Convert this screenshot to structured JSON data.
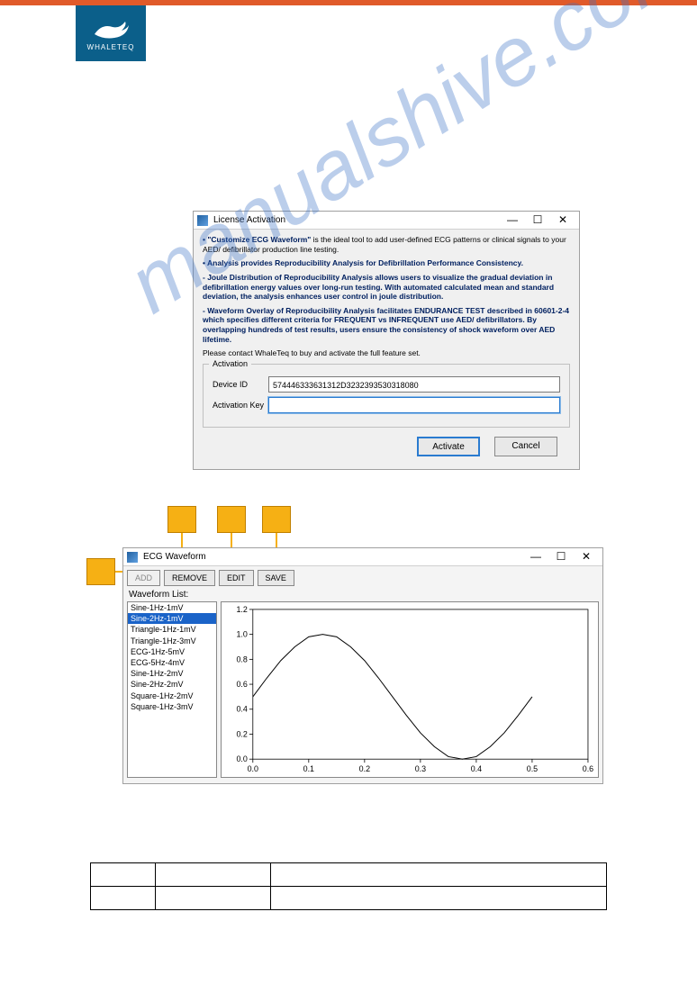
{
  "logo": {
    "text": "WHALETEQ"
  },
  "watermark": "manualshive.com",
  "license_dialog": {
    "title": "License Activation",
    "para1_lead": "• \"Customize ECG Waveform\"",
    "para1_rest": " is the ideal tool to add user-defined ECG patterns or clinical signals to your AED/ defibrillator production line testing.",
    "para2": "• Analysis provides Reproducibility Analysis for Defibrillation Performance Consistency.",
    "para3": "   - Joule Distribution of Reproducibility Analysis allows users to visualize the gradual deviation in defibrillation energy values over long-run testing. With automated calculated mean and standard deviation, the analysis enhances user control in joule distribution.",
    "para4": "   - Waveform Overlay of Reproducibility Analysis facilitates ENDURANCE TEST described in 60601-2-4 which specifies different criteria for FREQUENT vs INFREQUENT use AED/ defibrillators. By overlapping hundreds of test results, users ensure the consistency of shock waveform over AED lifetime.",
    "para5": "Please contact WhaleTeq to buy and activate the full feature set.",
    "group_legend": "Activation",
    "device_id_label": "Device ID",
    "device_id_value": "574446333631312D3232393530318080",
    "activation_key_label": "Activation Key",
    "activation_key_value": "",
    "activate_label": "Activate",
    "cancel_label": "Cancel"
  },
  "ecg_window": {
    "title": "ECG Waveform",
    "buttons": {
      "add": "ADD",
      "remove": "REMOVE",
      "edit": "EDIT",
      "save": "SAVE"
    },
    "list_label": "Waveform List:",
    "items": [
      "Sine-1Hz-1mV",
      "Sine-2Hz-1mV",
      "Triangle-1Hz-1mV",
      "Triangle-1Hz-3mV",
      "ECG-1Hz-5mV",
      "ECG-5Hz-4mV",
      "Sine-1Hz-2mV",
      "Sine-2Hz-2mV",
      "Square-1Hz-2mV",
      "Square-1Hz-3mV"
    ],
    "selected_index": 1
  },
  "chart_data": {
    "type": "line",
    "title": "",
    "xlabel": "",
    "ylabel": "",
    "xlim": [
      0.0,
      0.6
    ],
    "ylim": [
      0.0,
      1.2
    ],
    "xticks": [
      0.0,
      0.1,
      0.2,
      0.3,
      0.4,
      0.5,
      0.6
    ],
    "yticks": [
      0.0,
      0.2,
      0.4,
      0.6,
      0.8,
      1.0,
      1.2
    ],
    "x": [
      0.0,
      0.025,
      0.05,
      0.075,
      0.1,
      0.125,
      0.15,
      0.175,
      0.2,
      0.225,
      0.25,
      0.275,
      0.3,
      0.325,
      0.35,
      0.375,
      0.4,
      0.425,
      0.45,
      0.475,
      0.5
    ],
    "y": [
      0.5,
      0.65,
      0.79,
      0.9,
      0.98,
      1.0,
      0.98,
      0.9,
      0.79,
      0.65,
      0.5,
      0.35,
      0.21,
      0.1,
      0.02,
      0.0,
      0.02,
      0.1,
      0.21,
      0.35,
      0.5
    ]
  }
}
